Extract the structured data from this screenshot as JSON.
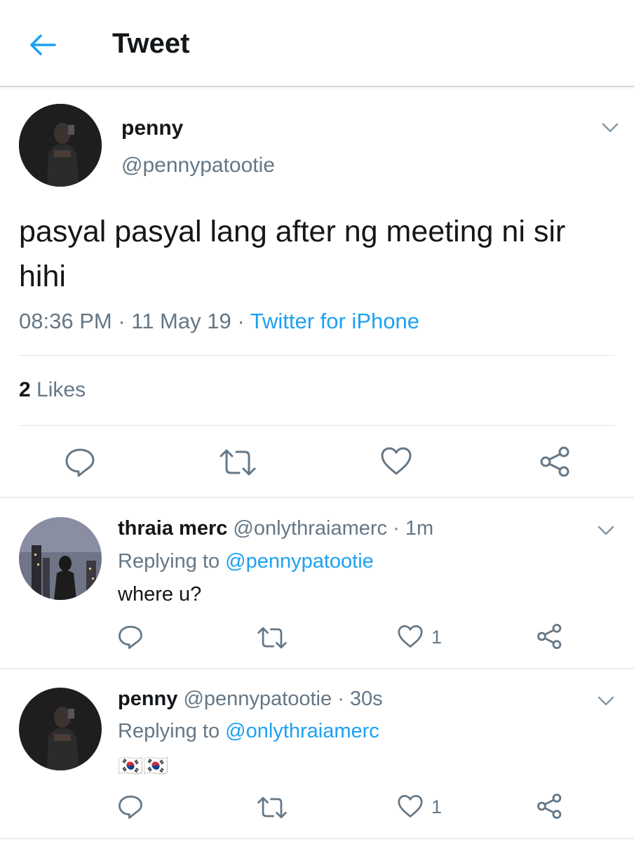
{
  "header": {
    "title": "Tweet"
  },
  "main_tweet": {
    "name": "penny",
    "handle": "@pennypatootie",
    "text": "pasyal pasyal lang after ng meeting ni sir hihi",
    "time": "08:36 PM",
    "date": "11 May 19",
    "source": "Twitter for iPhone",
    "likes_count": "2",
    "likes_label": "Likes"
  },
  "replies": [
    {
      "name": "thraia merc",
      "handle": "@onlythraiamerc",
      "age": "1m",
      "replying_label": "Replying to",
      "replying_to": "@pennypatootie",
      "text": "where u?",
      "like_count": "1"
    },
    {
      "name": "penny",
      "handle": "@pennypatootie",
      "age": "30s",
      "replying_label": "Replying to",
      "replying_to": "@onlythraiamerc",
      "text": "🇰🇷🇰🇷",
      "like_count": "1"
    }
  ],
  "colors": {
    "accent": "#1da1f2",
    "secondary_text": "#657786",
    "primary_text": "#14171a",
    "icon": "#657786"
  },
  "icons": [
    "back-arrow-icon",
    "chevron-down-icon",
    "reply-icon",
    "retweet-icon",
    "like-icon",
    "share-icon",
    "south-korea-flag-icon"
  ]
}
